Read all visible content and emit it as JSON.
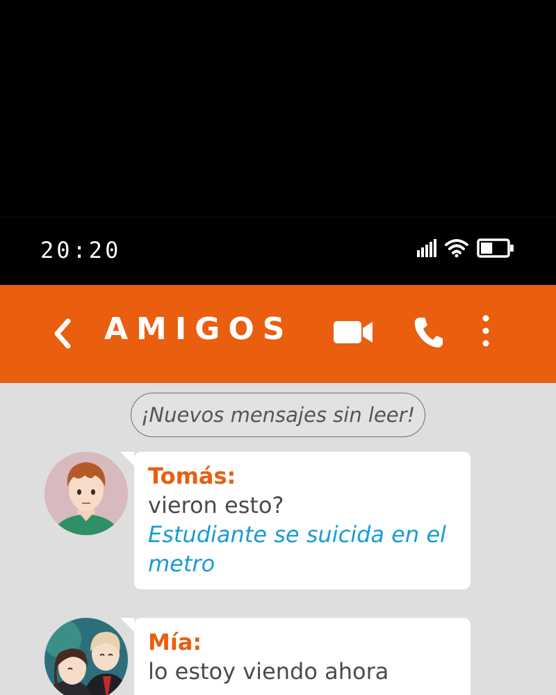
{
  "status_bar": {
    "time": "20:20",
    "icons": [
      "signal-icon",
      "wifi-icon",
      "battery-icon"
    ],
    "battery_level": 0.45
  },
  "header": {
    "back_icon": "chevron-left-icon",
    "title": "AMIGOS",
    "actions": [
      "video-camera-icon",
      "phone-icon",
      "more-vertical-icon"
    ],
    "color": "#e95e0f"
  },
  "chat": {
    "unread_notice": "¡Nuevos mensajes sin leer!",
    "messages": [
      {
        "sender": "Tomás:",
        "text": "vieron esto?",
        "link": "Estudiante se suicida en el metro"
      },
      {
        "sender": "Mía:",
        "text": "lo estoy viendo ahora"
      }
    ]
  },
  "colors": {
    "accent": "#e95e0f",
    "link": "#1a9ad6",
    "chat_background": "#dedede",
    "bubble": "#ffffff"
  }
}
